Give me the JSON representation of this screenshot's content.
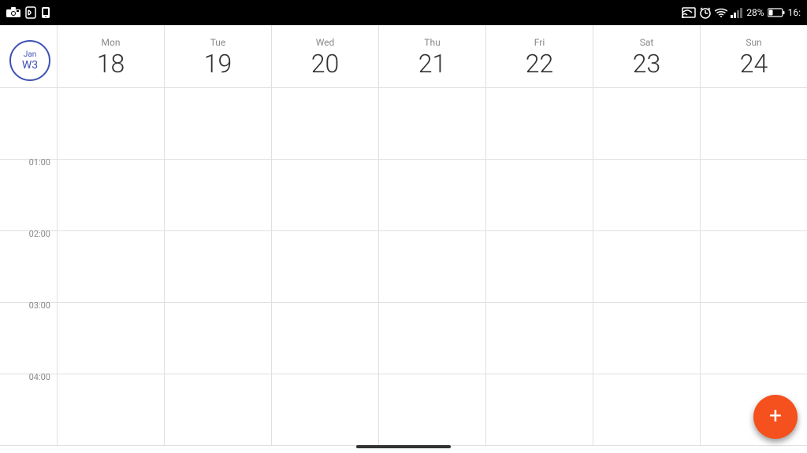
{
  "statusBar": {
    "leftIcons": [
      "camera-icon",
      "battery-status-icon",
      "phone-icon"
    ],
    "rightIcons": [
      "cast-icon",
      "alarm-icon",
      "wifi-icon",
      "signal-icon",
      "battery-icon"
    ],
    "batteryPercent": "28%",
    "time": "16:"
  },
  "calendar": {
    "days": [
      {
        "id": "jan",
        "name": "Jan",
        "number": "",
        "isMonth": true,
        "isToday": true,
        "weekLabel": "W3"
      },
      {
        "id": "mon18",
        "name": "Mon",
        "number": "18",
        "isToday": false
      },
      {
        "id": "tue19",
        "name": "Tue",
        "number": "19",
        "isToday": false
      },
      {
        "id": "wed20",
        "name": "Wed",
        "number": "20",
        "isToday": false
      },
      {
        "id": "thu21",
        "name": "Thu",
        "number": "21",
        "isToday": false
      },
      {
        "id": "fri22",
        "name": "Fri",
        "number": "22",
        "isToday": false
      },
      {
        "id": "sat23",
        "name": "Sat",
        "number": "23",
        "isToday": false
      },
      {
        "id": "sun24",
        "name": "Sun",
        "number": "24",
        "isToday": false
      }
    ],
    "timeSlots": [
      {
        "label": ""
      },
      {
        "label": "01:00"
      },
      {
        "label": "02:00"
      },
      {
        "label": "03:00"
      },
      {
        "label": "04:00"
      }
    ]
  },
  "fab": {
    "label": "+",
    "ariaLabel": "Add event"
  }
}
